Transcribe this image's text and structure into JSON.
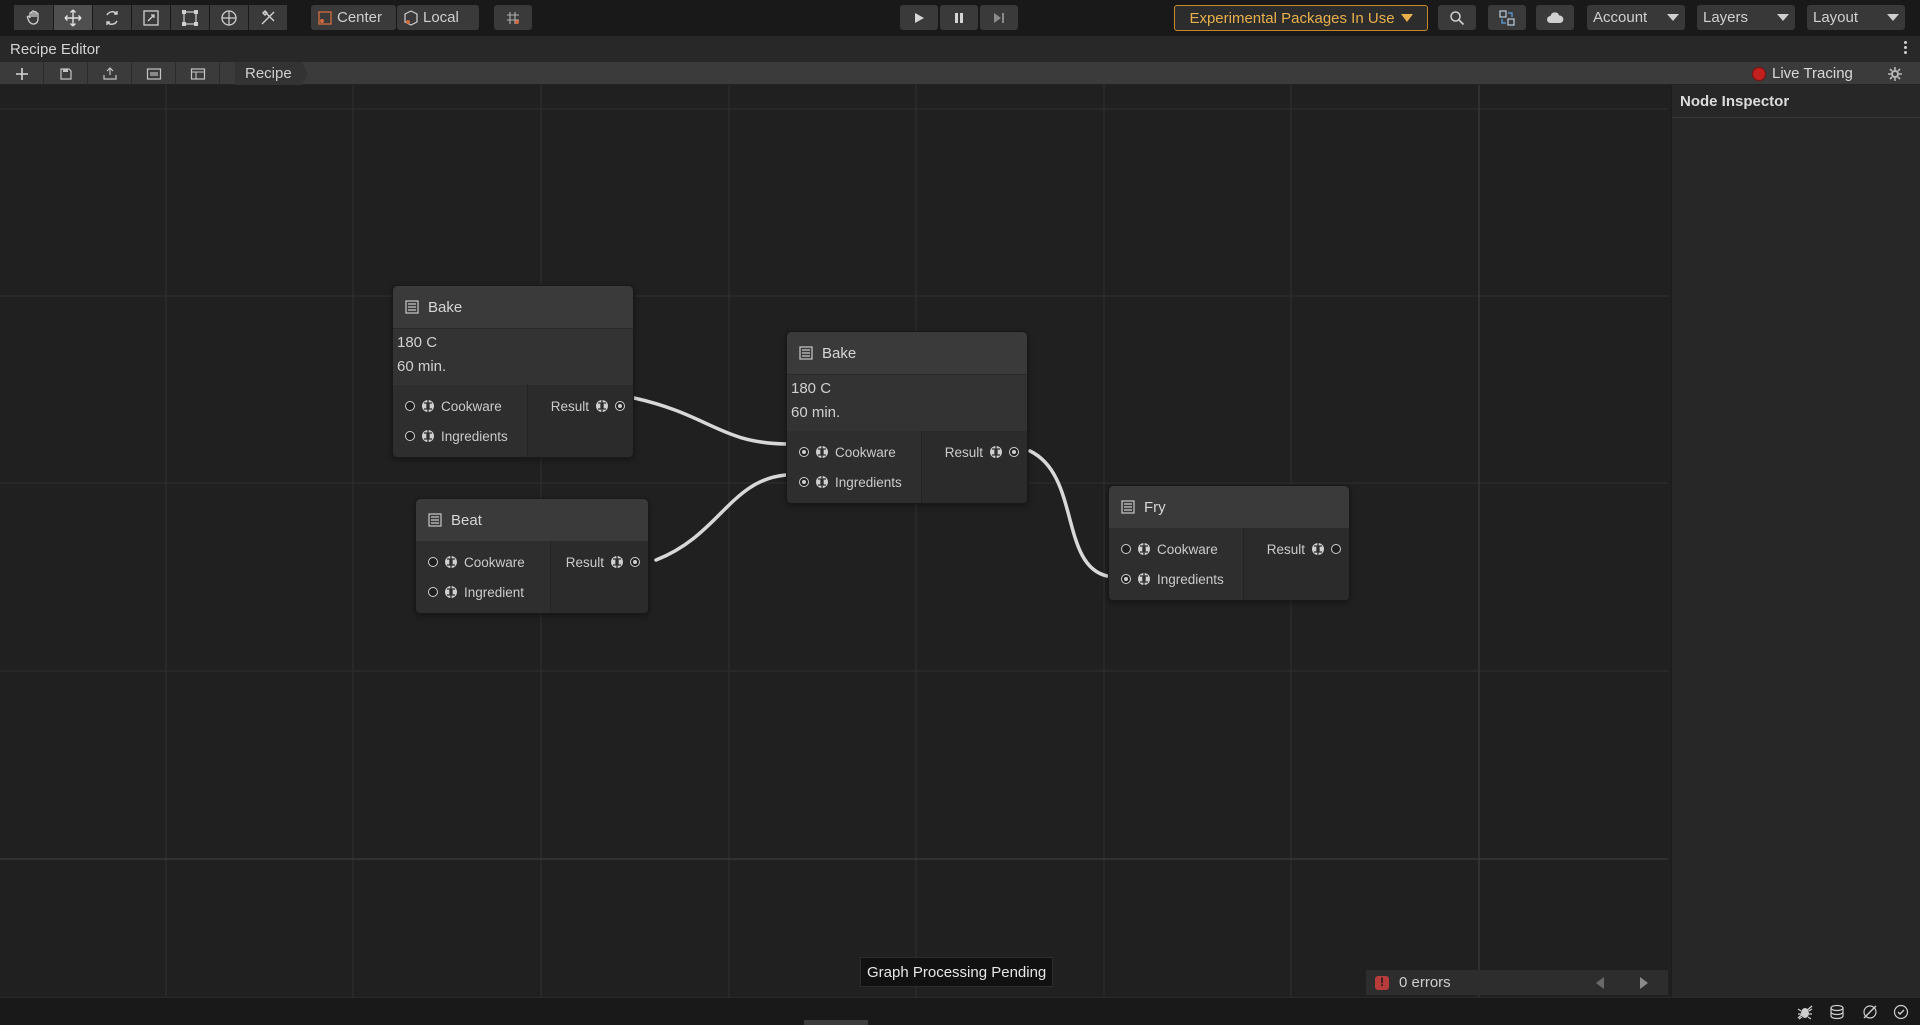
{
  "toolbar": {
    "tools": [
      {
        "name": "hand-tool-icon"
      },
      {
        "name": "move-tool-icon"
      },
      {
        "name": "rotate-tool-icon"
      },
      {
        "name": "scale-tool-icon"
      },
      {
        "name": "rect-tool-icon"
      },
      {
        "name": "transform-tool-icon"
      },
      {
        "name": "custom-tool-icon"
      }
    ],
    "pivot_label": "Center",
    "space_label": "Local",
    "experimental_label": "Experimental Packages In Use",
    "account_label": "Account",
    "layers_label": "Layers",
    "layout_label": "Layout"
  },
  "window": {
    "title": "Recipe Editor"
  },
  "editor_toolbar": {
    "breadcrumb": "Recipe",
    "live_tracing_label": "Live Tracing"
  },
  "nodes": {
    "bake1": {
      "title": "Bake",
      "props": [
        "180 C",
        "60 min."
      ],
      "inputs": [
        {
          "label": "Cookware",
          "connected": false
        },
        {
          "label": "Ingredients",
          "connected": false
        }
      ],
      "output": {
        "label": "Result",
        "connected": true
      }
    },
    "beat": {
      "title": "Beat",
      "inputs": [
        {
          "label": "Cookware",
          "connected": false
        },
        {
          "label": "Ingredient",
          "connected": false
        }
      ],
      "output": {
        "label": "Result",
        "connected": true
      }
    },
    "bake2": {
      "title": "Bake",
      "props": [
        "180 C",
        "60 min."
      ],
      "inputs": [
        {
          "label": "Cookware",
          "connected": true
        },
        {
          "label": "Ingredients",
          "connected": true
        }
      ],
      "output": {
        "label": "Result",
        "connected": true
      }
    },
    "fry": {
      "title": "Fry",
      "inputs": [
        {
          "label": "Cookware",
          "connected": false
        },
        {
          "label": "Ingredients",
          "connected": true
        }
      ],
      "output": {
        "label": "Result",
        "connected": false
      }
    }
  },
  "status": {
    "message": "Graph Processing Pending",
    "errors": "0 errors"
  },
  "inspector": {
    "title": "Node Inspector"
  }
}
